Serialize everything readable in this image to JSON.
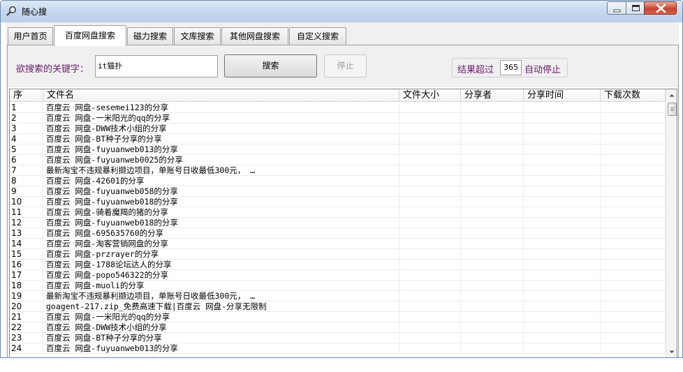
{
  "window": {
    "title": "随心搜"
  },
  "tabs": [
    "用户首页",
    "百度网盘搜索",
    "磁力搜索",
    "文库搜索",
    "其他网盘搜索",
    "自定义搜索"
  ],
  "active_tab": 1,
  "search": {
    "keyword_label": "欲搜索的关键字：",
    "keyword_value": "it猫扑",
    "search_button": "搜索",
    "stop_button": "停止",
    "limit_prefix": "结果超过",
    "limit_value": "365",
    "limit_suffix": "自动停止"
  },
  "table": {
    "columns": [
      "序",
      "文件名",
      "文件大小",
      "分享者",
      "分享时间",
      "下载次数"
    ],
    "rows": [
      {
        "idx": "1",
        "name": "百度云 网盘-sesemei123的分享"
      },
      {
        "idx": "2",
        "name": "百度云 网盘-一米阳光的qq的分享"
      },
      {
        "idx": "3",
        "name": "百度云 网盘-DWW技术小组的分享"
      },
      {
        "idx": "4",
        "name": "百度云 网盘-BT种子分享的分享"
      },
      {
        "idx": "5",
        "name": "百度云 网盘-fuyuanweb013的分享"
      },
      {
        "idx": "6",
        "name": "百度云 网盘-fuyuanweb0025的分享"
      },
      {
        "idx": "7",
        "name": "最新淘宝不违规暴利撷边项目，单账号日收最低300元， …"
      },
      {
        "idx": "8",
        "name": "百度云 网盘-42601的分享"
      },
      {
        "idx": "9",
        "name": "百度云 网盘-fuyuanweb058的分享"
      },
      {
        "idx": "10",
        "name": "百度云 网盘-fuyuanweb018的分享"
      },
      {
        "idx": "11",
        "name": "百度云 网盘-骑着魔羯的猪的分享"
      },
      {
        "idx": "12",
        "name": "百度云 网盘-fuyuanweb018的分享"
      },
      {
        "idx": "13",
        "name": "百度云 网盘-695635760的分享"
      },
      {
        "idx": "14",
        "name": "百度云 网盘-淘客营销网盘的分享"
      },
      {
        "idx": "15",
        "name": "百度云 网盘-przrayer的分享"
      },
      {
        "idx": "16",
        "name": "百度云 网盘-1788论坛达人的分享"
      },
      {
        "idx": "17",
        "name": "百度云 网盘-popo546322的分享"
      },
      {
        "idx": "18",
        "name": "百度云 网盘-muoli的分享"
      },
      {
        "idx": "19",
        "name": "最新淘宝不违规暴利撷边项目，单账号日收最低300元， …"
      },
      {
        "idx": "20",
        "name": "goagent-217.zip_免费高速下载|百度云 网盘-分享无限制"
      },
      {
        "idx": "21",
        "name": "百度云 网盘-一米阳光的qq的分享"
      },
      {
        "idx": "22",
        "name": "百度云 网盘-DWW技术小组的分享"
      },
      {
        "idx": "23",
        "name": "百度云 网盘-BT种子分享的分享"
      },
      {
        "idx": "24",
        "name": "百度云 网盘-fuyuanweb013的分享"
      }
    ]
  },
  "icons": {
    "app": "magnifier-icon",
    "minimize": "minimize-icon",
    "maximize": "maximize-icon",
    "close": "close-icon",
    "scroll_up": "scroll-up-arrow-icon",
    "scroll_down": "scroll-down-arrow-icon"
  },
  "colors": {
    "label_text": "#6a1b6a",
    "titlebar": "#c6d8ee",
    "close_button": "#c8442f",
    "panel_bg": "#f0f0f0"
  }
}
